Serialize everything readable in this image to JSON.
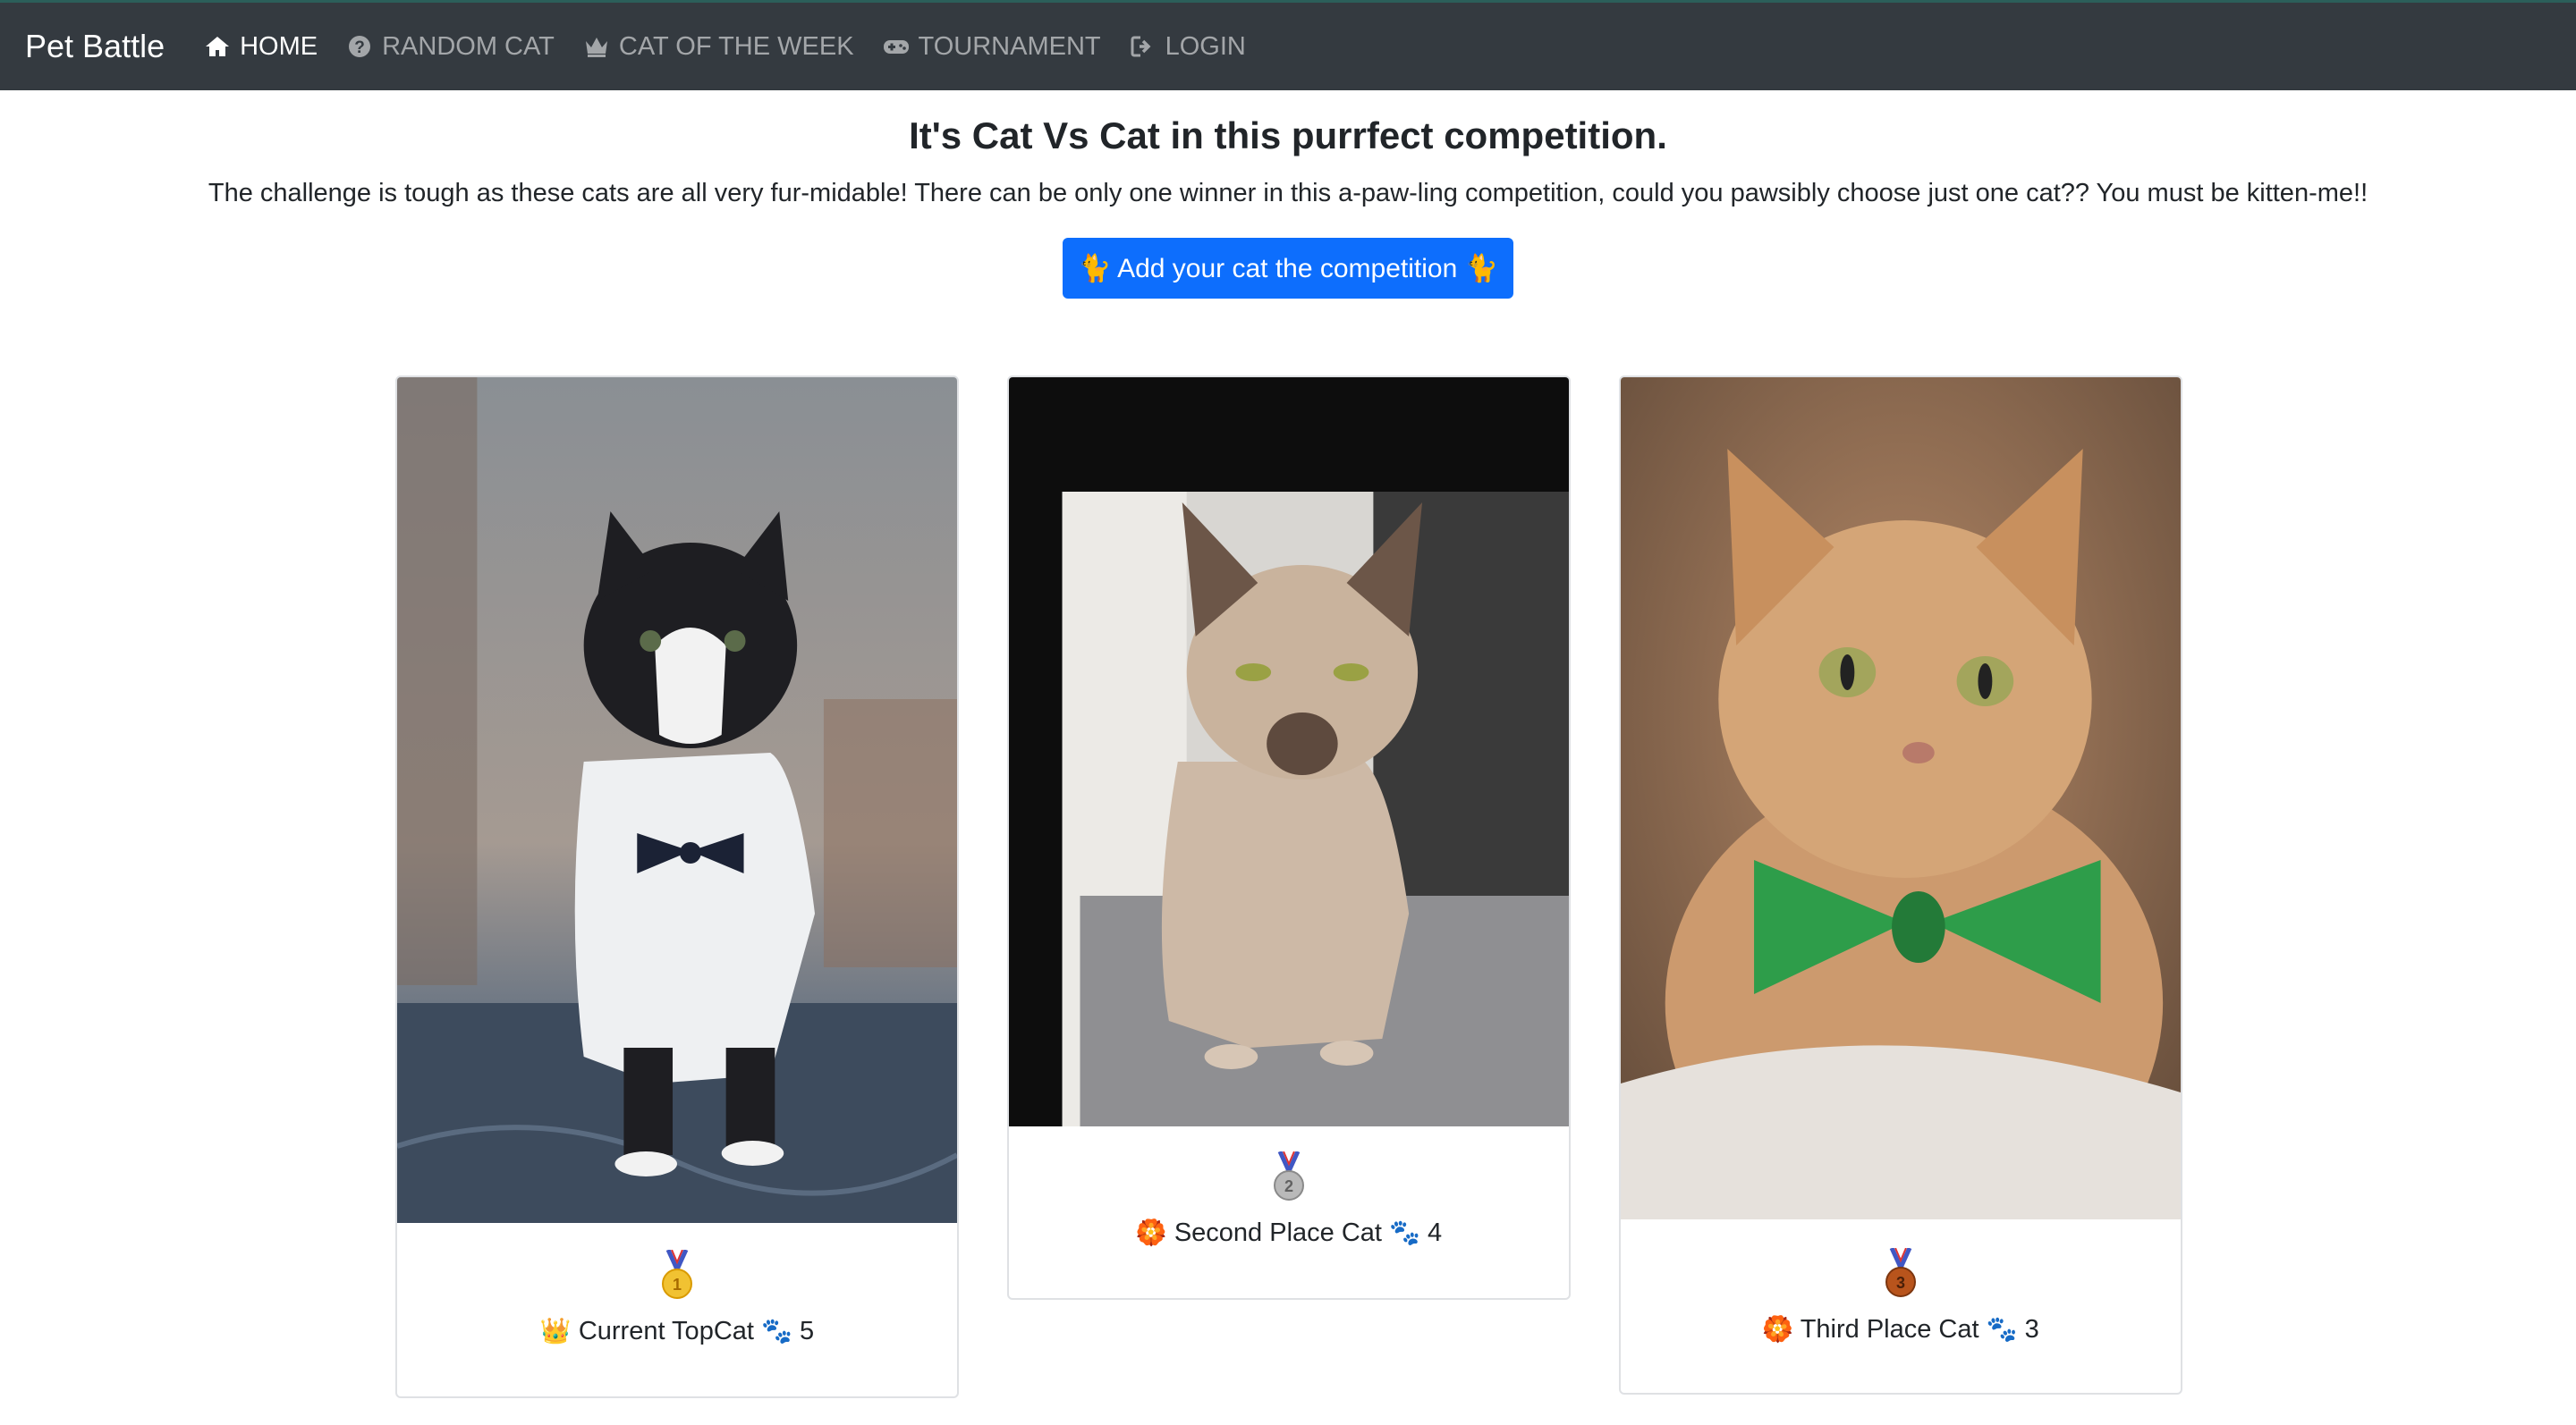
{
  "nav": {
    "brand": "Pet Battle",
    "items": [
      {
        "label": "HOME",
        "icon": "home-icon",
        "active": true
      },
      {
        "label": "RANDOM CAT",
        "icon": "question-circle-icon",
        "active": false
      },
      {
        "label": "CAT OF THE WEEK",
        "icon": "crown-icon",
        "active": false
      },
      {
        "label": "TOURNAMENT",
        "icon": "gamepad-icon",
        "active": false
      },
      {
        "label": "LOGIN",
        "icon": "sign-in-icon",
        "active": false
      }
    ]
  },
  "header": {
    "title": "It's Cat Vs Cat in this purrfect competition.",
    "subtitle": "The challenge is tough as these cats are all very fur-midable! There can be only one winner in this a-paw-ling competition, could you pawsibly choose just one cat?? You must be kitten-me!!",
    "cta_label": "🐈 Add your cat the competition 🐈"
  },
  "cards": [
    {
      "medal": "gold-medal-icon",
      "emoji": "👑",
      "label": "Current TopCat",
      "paws": "🐾",
      "votes": "5"
    },
    {
      "medal": "silver-medal-icon",
      "emoji": "🏵️",
      "label": "Second Place Cat",
      "paws": "🐾",
      "votes": "4"
    },
    {
      "medal": "bronze-medal-icon",
      "emoji": "🏵️",
      "label": "Third Place Cat",
      "paws": "🐾",
      "votes": "3"
    }
  ],
  "colors": {
    "navbar": "#343a40",
    "primary": "#0d6efd",
    "gold": "#f1c232",
    "silver": "#9e9e9e",
    "bronze": "#b8541c"
  }
}
